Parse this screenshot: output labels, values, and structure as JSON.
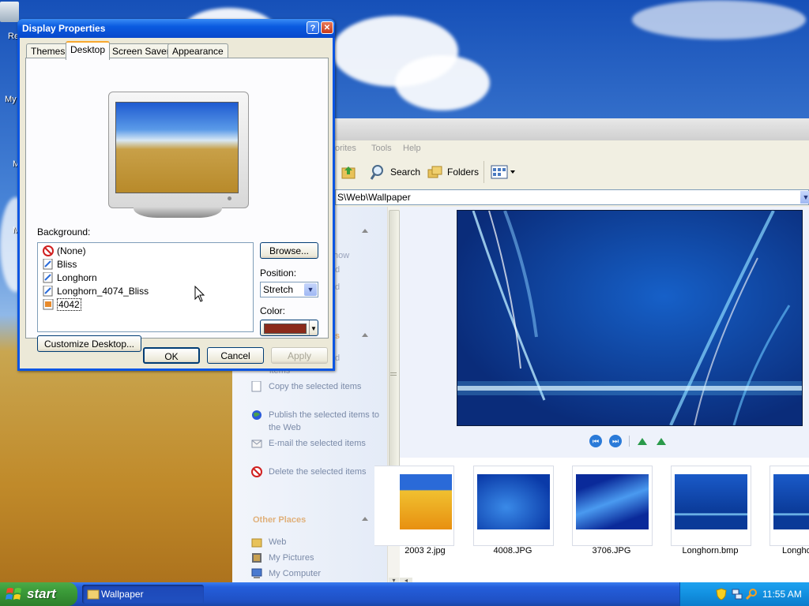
{
  "desktop": {
    "icon_labels": [
      "Re",
      "My",
      "M",
      "M"
    ]
  },
  "dialog": {
    "title": "Display Properties",
    "tabs": [
      "Themes",
      "Desktop",
      "Screen Saver",
      "Appearance"
    ],
    "active_tab": "Desktop",
    "background_label": "Background:",
    "background_items": [
      "(None)",
      "Bliss",
      "Longhorn",
      "Longhorn_4074_Bliss",
      "4042"
    ],
    "selected_item": "4042",
    "browse_label": "Browse...",
    "position_label": "Position:",
    "position_value": "Stretch",
    "color_label": "Color:",
    "color_value": "#8b2a1a",
    "customize_label": "Customize Desktop...",
    "ok_label": "OK",
    "cancel_label": "Cancel",
    "apply_label": "Apply",
    "help_label": "?",
    "close_label": "✕"
  },
  "explorer": {
    "menu": [
      "orites",
      "Tools",
      "Help"
    ],
    "toolbar": {
      "search": "Search",
      "folders": "Folders"
    },
    "address": "S\\Web\\Wallpaper",
    "taskpane": {
      "partial_items": [
        "how",
        "d",
        "d",
        "s",
        "d",
        "items"
      ],
      "file_tasks": [
        {
          "icon": "copy-icon",
          "label": "Copy the selected items"
        },
        {
          "icon": "globe-icon",
          "label": "Publish the selected items to the Web"
        },
        {
          "icon": "email-icon",
          "label": "E-mail the selected items"
        },
        {
          "icon": "delete-icon",
          "label": "Delete the selected items"
        }
      ],
      "other_places_heading": "Other Places",
      "other_places": [
        {
          "icon": "folder-icon",
          "label": "Web"
        },
        {
          "icon": "pictures-icon",
          "label": "My Pictures"
        },
        {
          "icon": "computer-icon",
          "label": "My Computer"
        }
      ]
    },
    "thumbnails": [
      "2003 2.jpg",
      "4008.JPG",
      "3706.JPG",
      "Longhorn.bmp",
      "Longho"
    ]
  },
  "taskbar": {
    "start_label": "start",
    "task": "Wallpaper",
    "clock": "11:55 AM"
  },
  "colors": {
    "xp_blue": "#0a55e3",
    "start_green": "#3a9a38",
    "tray_blue": "#1290e0"
  }
}
